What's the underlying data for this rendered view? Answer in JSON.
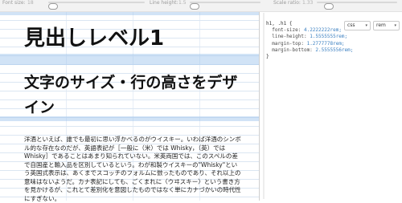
{
  "controls": {
    "font_size_label": "Font size:",
    "font_size_value": "18",
    "line_height_label": "Line height:",
    "line_height_value": "1.5",
    "scale_ratio_label": "Scale ratio:",
    "scale_ratio_value": "1.33"
  },
  "preview": {
    "h1": "見出しレベル1",
    "h2": "文字のサイズ・行の高さをデザイン",
    "paragraph": "洋酒といえば、誰でも最初に思い浮かべるのがウイスキー。いわば洋酒のシンボル的な存在なのだが、英語表記が［一般に（米）では Whisky，（英）では Whisky］であることはあまり知られていない。米英両国では、このスペルの差で自国産と輸入品を区別しているという。わが和製ウイスキーの\"Whisky\"という英国式表示は、あくまでスコッチのフォルムに倣ったものであり、それ以上の意味はないようだ。カナ表記にしても、ごくまれに〈ウヰスキー〉という書き方を見かけるが、これとて差別化を意図したものではなく単にカナづかいの時代性にすぎない。"
  },
  "css_panel": {
    "syntax_select": "css",
    "unit_select": "rem",
    "lines": [
      {
        "t": "h1, .h1",
        "c": "sel",
        "pre": "",
        "post": " {"
      },
      {
        "t": "font-size: ",
        "c": "prop",
        "pre": "  ",
        "v": "4.2222222rem;"
      },
      {
        "t": "line-height: ",
        "c": "prop",
        "pre": "  ",
        "v": "1.5555555rem;"
      },
      {
        "t": "margin-top: ",
        "c": "prop",
        "pre": "  ",
        "v": "1.2777778rem;"
      },
      {
        "t": "margin-bottom: ",
        "c": "prop",
        "pre": "  ",
        "v": "2.5555556rem;"
      },
      {
        "t": "}",
        "c": "sel",
        "pre": "",
        "post": ""
      }
    ]
  }
}
